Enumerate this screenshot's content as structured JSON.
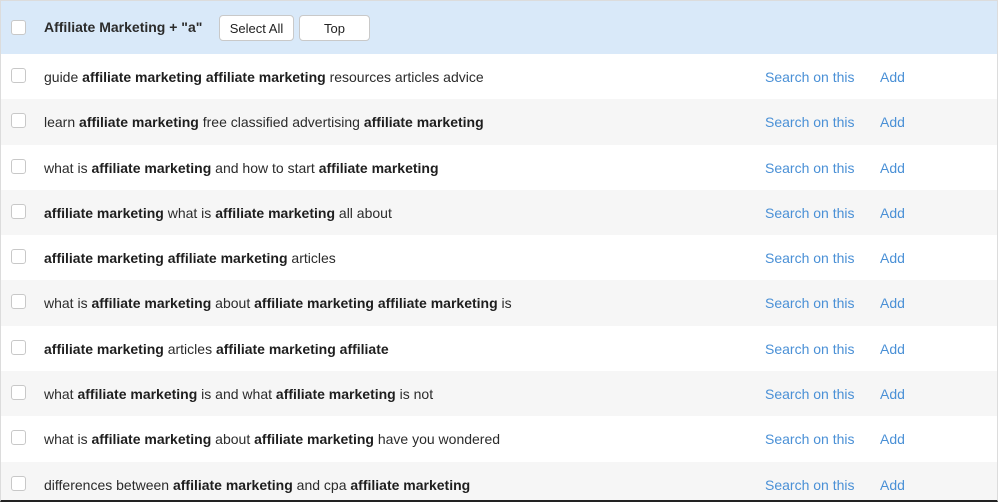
{
  "header": {
    "group_title": "Affiliate Marketing + \"a\"",
    "select_all_label": "Select All",
    "top_label": "Top"
  },
  "actions": {
    "search_label": "Search on this",
    "add_label": "Add"
  },
  "colors": {
    "header_bg": "#d9e9f9",
    "link": "#4a90d6",
    "row_alt_bg": "#f6f6f6"
  },
  "rows": [
    {
      "parts": [
        [
          "guide ",
          false
        ],
        [
          "affiliate marketing affiliate marketing",
          true
        ],
        [
          " resources articles advice",
          false
        ]
      ]
    },
    {
      "parts": [
        [
          "learn ",
          false
        ],
        [
          "affiliate marketing",
          true
        ],
        [
          " free classified advertising ",
          false
        ],
        [
          "affiliate marketing",
          true
        ]
      ]
    },
    {
      "parts": [
        [
          "what is ",
          false
        ],
        [
          "affiliate marketing",
          true
        ],
        [
          " and how to start ",
          false
        ],
        [
          "affiliate marketing",
          true
        ]
      ]
    },
    {
      "parts": [
        [
          "affiliate marketing",
          true
        ],
        [
          " what is ",
          false
        ],
        [
          "affiliate marketing",
          true
        ],
        [
          " all about",
          false
        ]
      ]
    },
    {
      "parts": [
        [
          "affiliate marketing affiliate marketing",
          true
        ],
        [
          " articles",
          false
        ]
      ]
    },
    {
      "parts": [
        [
          "what is ",
          false
        ],
        [
          "affiliate marketing",
          true
        ],
        [
          " about ",
          false
        ],
        [
          "affiliate marketing affiliate marketing",
          true
        ],
        [
          " is",
          false
        ]
      ]
    },
    {
      "parts": [
        [
          "affiliate marketing",
          true
        ],
        [
          " articles ",
          false
        ],
        [
          "affiliate marketing affiliate",
          true
        ]
      ]
    },
    {
      "parts": [
        [
          "what ",
          false
        ],
        [
          "affiliate marketing",
          true
        ],
        [
          " is and what ",
          false
        ],
        [
          "affiliate marketing",
          true
        ],
        [
          " is not",
          false
        ]
      ]
    },
    {
      "parts": [
        [
          "what is ",
          false
        ],
        [
          "affiliate marketing",
          true
        ],
        [
          " about ",
          false
        ],
        [
          "affiliate marketing",
          true
        ],
        [
          " have you wondered",
          false
        ]
      ]
    },
    {
      "parts": [
        [
          "differences between ",
          false
        ],
        [
          "affiliate marketing",
          true
        ],
        [
          " and cpa ",
          false
        ],
        [
          "affiliate marketing",
          true
        ]
      ]
    }
  ]
}
